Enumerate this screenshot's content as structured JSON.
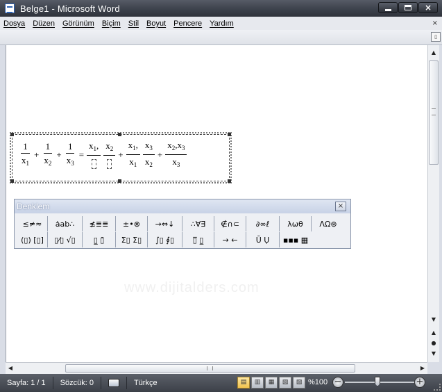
{
  "window": {
    "title": "Belge1 - Microsoft Word",
    "app_icon": "word-document-icon",
    "controls": [
      "minimize-icon",
      "maximize-icon",
      "close-icon"
    ]
  },
  "menu": {
    "items": [
      "Dosya",
      "Düzen",
      "Görünüm",
      "Biçim",
      "Stil",
      "Boyut",
      "Pencere",
      "Yardım"
    ],
    "close_glyph": "×"
  },
  "ruler": {
    "corner_glyph": "▯"
  },
  "equation": {
    "lhs": [
      {
        "num": "1",
        "den": "x",
        "sub": "1"
      },
      {
        "num": "1",
        "den": "x",
        "sub": "2"
      },
      {
        "num": "1",
        "den": "x",
        "sub": "3"
      }
    ],
    "plus": "+",
    "equals": "=",
    "rhs": [
      {
        "num": "x",
        "num_sub": "1",
        "den": "⬚"
      },
      {
        "num": "x",
        "num_sub": "2",
        "den": "⬚"
      },
      {
        "num": "x",
        "num_sub": "1",
        "den": "x",
        "den_sub": "1"
      },
      {
        "num": "x",
        "num_sub": "3",
        "den": "x",
        "den_sub": "2"
      },
      {
        "num": "x",
        "num_sub": "2",
        "num_sub2": "x",
        "num_sub2_sub": "3",
        "den": "x",
        "den_sub": "3"
      }
    ],
    "comma": ","
  },
  "toolbar": {
    "title": "Denklem",
    "close_glyph": "×",
    "row1": [
      "≤≠≈",
      "ȧab∴",
      "≰≣≣",
      "±•⊗",
      "→⇔↓",
      "∴∀∃",
      "∉∩⊂",
      "∂∞ℓ",
      "λωθ",
      "ΛΩ⊛"
    ],
    "row2": [
      "(▯) [▯]",
      "▯⁄▯ √▯",
      "▯̲ ▯̄",
      "Σ▯ Σ▯",
      "∫▯ ∮▯",
      "▯̅ ▯̲",
      "→ ←",
      "Ū Ụ",
      "▪▪▪ ▦"
    ]
  },
  "watermark": "www.dijitalders.com",
  "scroll": {
    "up": "▲",
    "down": "▼",
    "left": "◀",
    "right": "▶",
    "prev_page": "▲",
    "browse": "●",
    "next_page": "▼"
  },
  "status": {
    "page": "Sayfa: 1 / 1",
    "words": "Sözcük: 0",
    "language": "Türkçe",
    "zoom": "%100",
    "zoom_minus": "−",
    "zoom_plus": "+",
    "views": [
      "▤",
      "▥",
      "▦",
      "▧",
      "▨"
    ]
  }
}
